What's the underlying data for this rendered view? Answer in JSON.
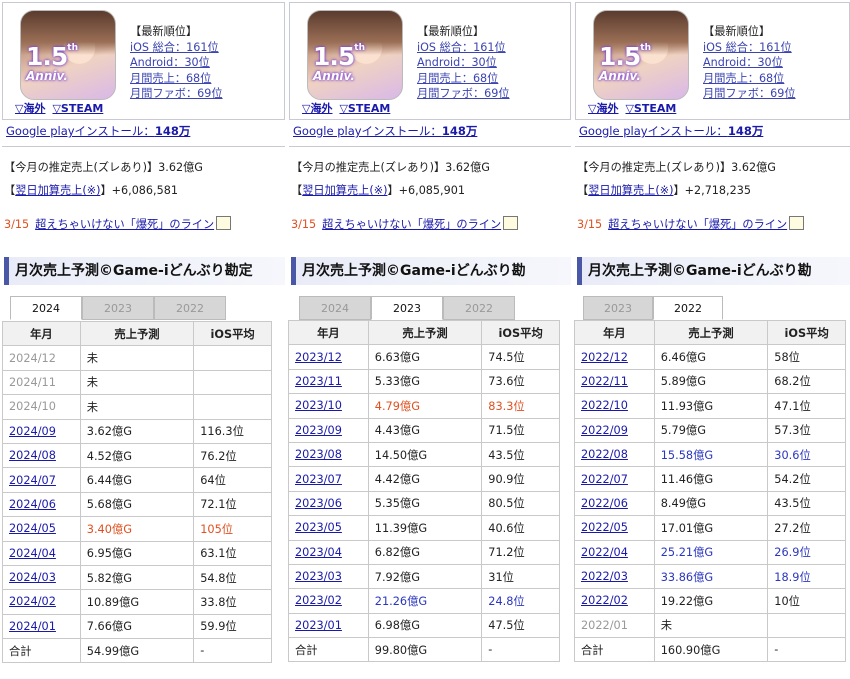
{
  "panels": [
    {
      "region_links": [
        "▽海外",
        "▽STEAM"
      ],
      "icon_text": {
        "big": "1.5",
        "th": "th",
        "sub": "Anniv."
      },
      "ranking": {
        "header": "【最新順位】",
        "items": [
          "iOS 総合：161位",
          "Android：30位",
          "月間売上：68位",
          "月間ファボ：69位"
        ]
      },
      "gp_label": "Google playインストール：",
      "gp_value": "148万",
      "est_label": "【今月の推定売上(ズレあり)】",
      "est_value": "3.62億G",
      "next_label": "翌日加算売上(※)",
      "next_prefix": "【",
      "next_suffix": "】",
      "next_value": "+6,086,581",
      "back_date": "3/15",
      "back_text": "超えちゃいけない「爆死」のライン",
      "section_title": "月次売上予測©Game-iどんぶり勘定",
      "tabs": [
        {
          "label": "2024",
          "active": true
        },
        {
          "label": "2023",
          "active": false
        },
        {
          "label": "2022",
          "active": false
        }
      ],
      "columns": [
        "年月",
        "売上予測",
        "iOS平均"
      ],
      "rows": [
        {
          "month": "2024/12",
          "sales": "未",
          "ios": "",
          "gray": true
        },
        {
          "month": "2024/11",
          "sales": "未",
          "ios": "",
          "gray": true
        },
        {
          "month": "2024/10",
          "sales": "未",
          "ios": "",
          "gray": true
        },
        {
          "month": "2024/09",
          "sales": "3.62億G",
          "ios": "116.3位"
        },
        {
          "month": "2024/08",
          "sales": "4.52億G",
          "ios": "76.2位"
        },
        {
          "month": "2024/07",
          "sales": "6.44億G",
          "ios": "64位"
        },
        {
          "month": "2024/06",
          "sales": "5.68億G",
          "ios": "72.1位"
        },
        {
          "month": "2024/05",
          "sales": "3.40億G",
          "ios": "105位",
          "tone": "orange"
        },
        {
          "month": "2024/04",
          "sales": "6.95億G",
          "ios": "63.1位"
        },
        {
          "month": "2024/03",
          "sales": "5.82億G",
          "ios": "54.8位"
        },
        {
          "month": "2024/02",
          "sales": "10.89億G",
          "ios": "33.8位"
        },
        {
          "month": "2024/01",
          "sales": "7.66億G",
          "ios": "59.9位"
        }
      ],
      "total": {
        "label": "合計",
        "sales": "54.99億G",
        "ios": "-"
      }
    },
    {
      "region_links": [
        "▽海外",
        "▽STEAM"
      ],
      "icon_text": {
        "big": "1.5",
        "th": "th",
        "sub": "Anniv."
      },
      "ranking": {
        "header": "【最新順位】",
        "items": [
          "iOS 総合：161位",
          "Android：30位",
          "月間売上：68位",
          "月間ファボ：69位"
        ]
      },
      "gp_label": "Google playインストール：",
      "gp_value": "148万",
      "est_label": "【今月の推定売上(ズレあり)】",
      "est_value": "3.62億G",
      "next_label": "翌日加算売上(※)",
      "next_prefix": "【",
      "next_suffix": "】",
      "next_value": "+6,085,901",
      "back_date": "3/15",
      "back_text": "超えちゃいけない「爆死」のライン",
      "section_title": "月次売上予測©Game-iどんぶり勘",
      "tabs": [
        {
          "label": "2024",
          "active": false
        },
        {
          "label": "2023",
          "active": true
        },
        {
          "label": "2022",
          "active": false
        }
      ],
      "columns": [
        "年月",
        "売上予測",
        "iOS平均"
      ],
      "rows": [
        {
          "month": "2023/12",
          "sales": "6.63億G",
          "ios": "74.5位"
        },
        {
          "month": "2023/11",
          "sales": "5.33億G",
          "ios": "73.6位"
        },
        {
          "month": "2023/10",
          "sales": "4.79億G",
          "ios": "83.3位",
          "tone": "orange"
        },
        {
          "month": "2023/09",
          "sales": "4.43億G",
          "ios": "71.5位"
        },
        {
          "month": "2023/08",
          "sales": "14.50億G",
          "ios": "43.5位"
        },
        {
          "month": "2023/07",
          "sales": "4.42億G",
          "ios": "90.9位"
        },
        {
          "month": "2023/06",
          "sales": "5.35億G",
          "ios": "80.5位"
        },
        {
          "month": "2023/05",
          "sales": "11.39億G",
          "ios": "40.6位"
        },
        {
          "month": "2023/04",
          "sales": "6.82億G",
          "ios": "71.2位"
        },
        {
          "month": "2023/03",
          "sales": "7.92億G",
          "ios": "31位"
        },
        {
          "month": "2023/02",
          "sales": "21.26億G",
          "ios": "24.8位",
          "tone": "blue"
        },
        {
          "month": "2023/01",
          "sales": "6.98億G",
          "ios": "47.5位"
        }
      ],
      "total": {
        "label": "合計",
        "sales": "99.80億G",
        "ios": "-"
      }
    },
    {
      "region_links": [
        "▽海外",
        "▽STEAM"
      ],
      "icon_text": {
        "big": "1.5",
        "th": "th",
        "sub": "Anniv."
      },
      "ranking": {
        "header": "【最新順位】",
        "items": [
          "iOS 総合：161位",
          "Android：30位",
          "月間売上：68位",
          "月間ファボ：69位"
        ]
      },
      "gp_label": "Google playインストール：",
      "gp_value": "148万",
      "est_label": "【今月の推定売上(ズレあり)】",
      "est_value": "3.62億G",
      "next_label": "翌日加算売上(※)",
      "next_prefix": "【",
      "next_suffix": "】",
      "next_value": "+2,718,235",
      "back_date": "3/15",
      "back_text": "超えちゃいけない「爆死」のライン",
      "section_title": "月次売上予測©Game-iどんぶり勘",
      "tabs": [
        {
          "label": "2023",
          "active": false
        },
        {
          "label": "2022",
          "active": true
        }
      ],
      "columns": [
        "年月",
        "売上予測",
        "iOS平均"
      ],
      "rows": [
        {
          "month": "2022/12",
          "sales": "6.46億G",
          "ios": "58位"
        },
        {
          "month": "2022/11",
          "sales": "5.89億G",
          "ios": "68.2位"
        },
        {
          "month": "2022/10",
          "sales": "11.93億G",
          "ios": "47.1位"
        },
        {
          "month": "2022/09",
          "sales": "5.79億G",
          "ios": "57.3位"
        },
        {
          "month": "2022/08",
          "sales": "15.58億G",
          "ios": "30.6位",
          "tone": "blue"
        },
        {
          "month": "2022/07",
          "sales": "11.46億G",
          "ios": "54.2位"
        },
        {
          "month": "2022/06",
          "sales": "8.49億G",
          "ios": "43.5位"
        },
        {
          "month": "2022/05",
          "sales": "17.01億G",
          "ios": "27.2位"
        },
        {
          "month": "2022/04",
          "sales": "25.21億G",
          "ios": "26.9位",
          "tone": "blue"
        },
        {
          "month": "2022/03",
          "sales": "33.86億G",
          "ios": "18.9位",
          "tone": "blue"
        },
        {
          "month": "2022/02",
          "sales": "19.22億G",
          "ios": "10位"
        },
        {
          "month": "2022/01",
          "sales": "未",
          "ios": "",
          "gray": true
        }
      ],
      "total": {
        "label": "合計",
        "sales": "160.90億G",
        "ios": "-"
      }
    }
  ],
  "colors": {
    "link": "#1a1aaa",
    "rank_link": "#3b44b0",
    "highlight_low": "#e05020",
    "highlight_high": "#2a36c0",
    "section_accent": "#4a56a6"
  }
}
